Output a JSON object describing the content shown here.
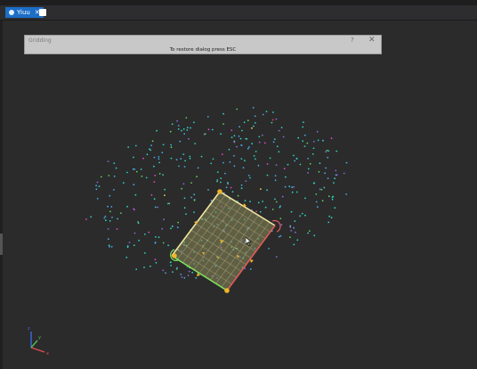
{
  "window": {
    "tab_label": "Yiuu",
    "tab_close_glyph": "✕",
    "tab_icon": "view-icon",
    "new_tab_icon": "new-document-icon"
  },
  "dialog": {
    "title": "Gridding",
    "help_glyph": "?",
    "close_glyph": "✕",
    "message": "To restore dialog press ESC"
  },
  "viewport": {
    "background": "#2b2b2b",
    "plane_fill": "#8a8a5a",
    "edge_colors": {
      "top": "#f1e6a0",
      "right": "#e05a5a",
      "bottom": "#7ee05a",
      "left": "#f1e6a0"
    },
    "handle_color": "#f0b428",
    "point_colors": [
      "#2fd0c0",
      "#4aa8e8",
      "#8a6ae0",
      "#5ad05a",
      "#e04ad0",
      "#f0d040",
      "#e05050"
    ]
  },
  "axes": {
    "x_label": "x",
    "y_label": "y",
    "z_label": "z"
  }
}
